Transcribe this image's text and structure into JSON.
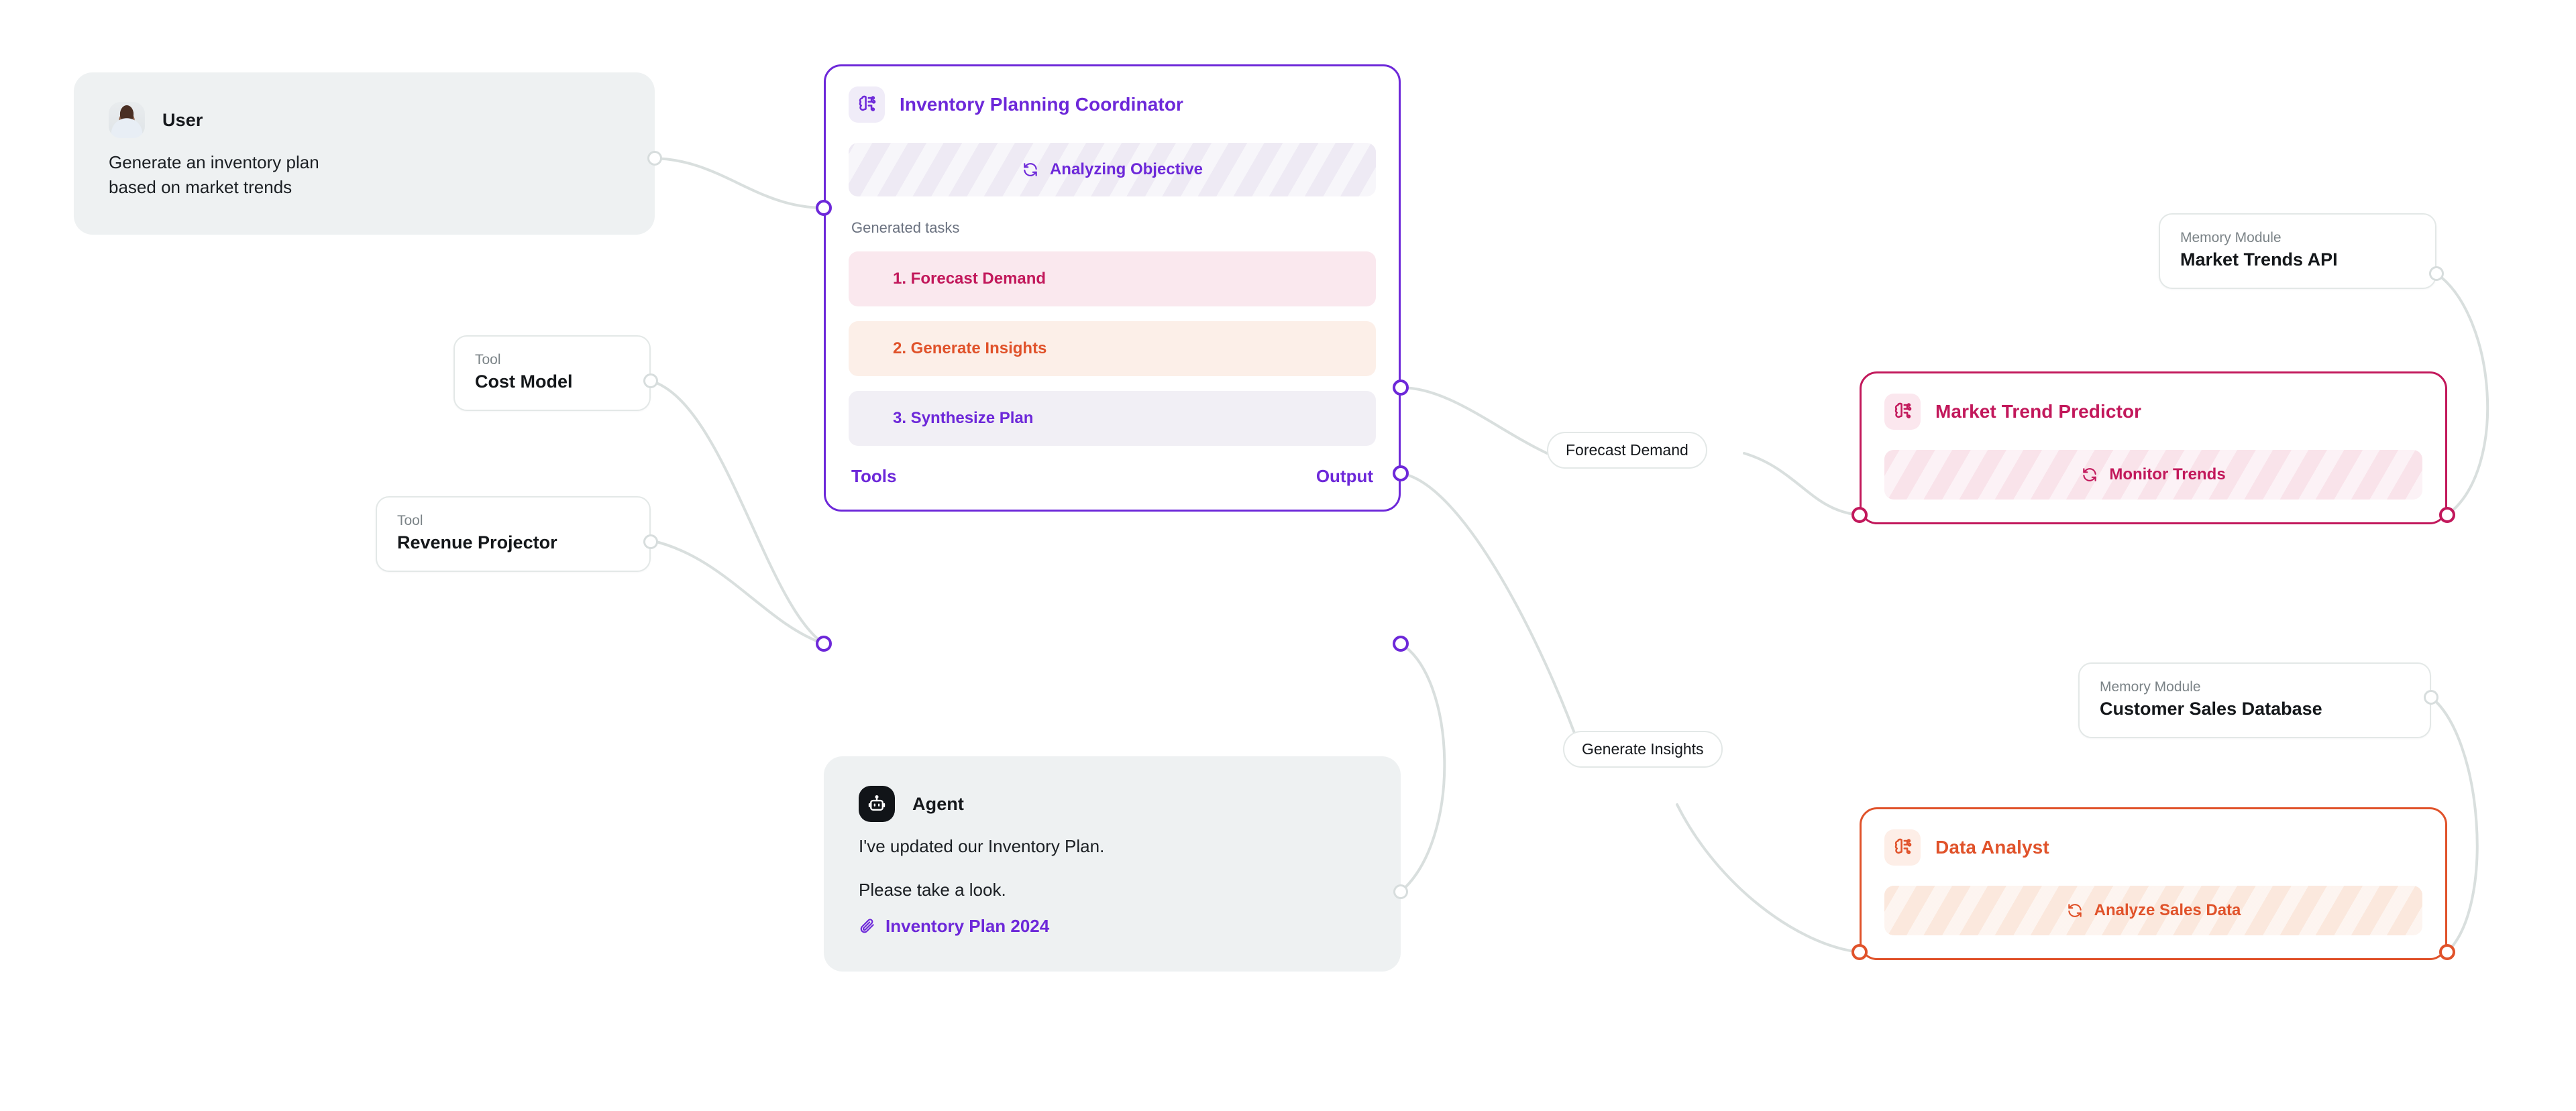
{
  "canvas": {
    "background": "#ffffff"
  },
  "colors": {
    "purple": "#6d28d9",
    "crimson": "#c2185b",
    "orange": "#e0522a",
    "edge": "#d9dfde",
    "bubble_bg": "#eef1f2",
    "task_forecast_bg": "#fae8ee",
    "task_insights_bg": "#fcefe8",
    "task_synth_bg": "#f1eff5"
  },
  "user_message": {
    "name": "User",
    "avatar_icon": "user-photo-avatar",
    "line1": "Generate an inventory plan",
    "line2": "based on market trends"
  },
  "agent_message": {
    "name": "Agent",
    "avatar_icon": "robot-icon",
    "line1": "I've updated our Inventory Plan.",
    "line2": "Please take a look.",
    "attachment_icon": "paperclip-icon",
    "attachment_label": "Inventory Plan 2024"
  },
  "tools": [
    {
      "kind": "Tool",
      "title": "Cost Model"
    },
    {
      "kind": "Tool",
      "title": "Revenue Projector"
    }
  ],
  "memory_modules": [
    {
      "kind": "Memory Module",
      "title": "Market Trends API"
    },
    {
      "kind": "Memory Module",
      "title": "Customer Sales Database"
    }
  ],
  "coordinator": {
    "icon": "brain-circuit-icon",
    "title": "Inventory Planning Coordinator",
    "status": {
      "icon": "refresh-icon",
      "label": "Analyzing Objective"
    },
    "tasks_label": "Generated tasks",
    "tasks": [
      {
        "label": "1. Forecast Demand",
        "color": "#c2185b",
        "bg": "#fae8ee"
      },
      {
        "label": "2. Generate Insights",
        "color": "#e0522a",
        "bg": "#fcefe8"
      },
      {
        "label": "3. Synthesize Plan",
        "color": "#6d28d9",
        "bg": "#f1eff5"
      }
    ],
    "footer_left": "Tools",
    "footer_right": "Output"
  },
  "sub_agents": [
    {
      "icon": "brain-circuit-icon",
      "title": "Market Trend Predictor",
      "color": "#c2185b",
      "icon_bg": "#fbe7ee",
      "pill_bg": "#f9e3ea",
      "status": {
        "icon": "refresh-icon",
        "label": "Monitor Trends"
      }
    },
    {
      "icon": "brain-circuit-icon",
      "title": "Data Analyst",
      "color": "#e0522a",
      "icon_bg": "#fdeee7",
      "pill_bg": "#fbe8dd",
      "status": {
        "icon": "refresh-icon",
        "label": "Analyze Sales Data"
      }
    }
  ],
  "edge_labels": [
    {
      "label": "Forecast Demand"
    },
    {
      "label": "Generate Insights"
    }
  ]
}
